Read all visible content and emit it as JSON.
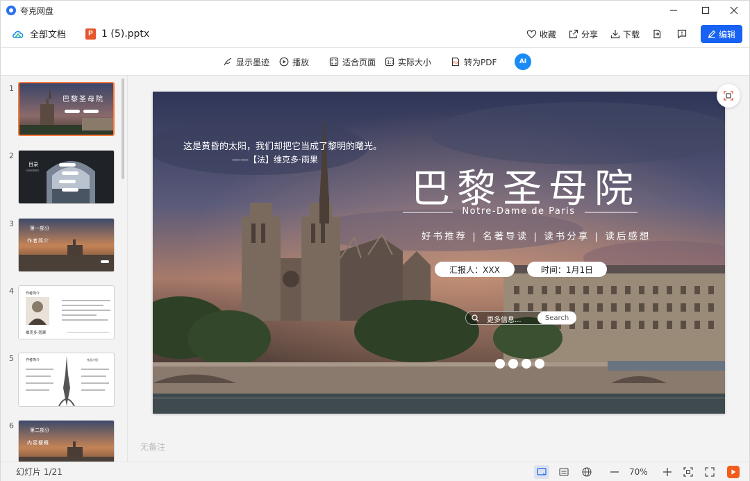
{
  "app": {
    "title": "夸克网盘"
  },
  "window_controls": {
    "minimize": "—",
    "maximize": "☐",
    "close": "✕"
  },
  "header": {
    "all_docs": "全部文档",
    "file_name": "1 (5).pptx",
    "ppt_badge": "P",
    "favorite": "收藏",
    "share": "分享",
    "download": "下载",
    "edit": "编辑"
  },
  "toolbar": {
    "show_ink": "显示墨迹",
    "play": "播放",
    "fit_page": "适合页面",
    "actual_size": "实际大小",
    "to_pdf": "转为PDF",
    "ai": "AI"
  },
  "thumbnails": [
    {
      "num": "1",
      "active": true
    },
    {
      "num": "2"
    },
    {
      "num": "3"
    },
    {
      "num": "4"
    },
    {
      "num": "5"
    },
    {
      "num": "6"
    }
  ],
  "thumb_text": {
    "t2_title": "目录",
    "t2_sub": "CONTENTS",
    "t3_title": "第一部分",
    "t3_sub": "作者简介",
    "t4_title": "作者简介",
    "t4_name": "维克多·雨果",
    "t5_title": "作者简介",
    "t5_right": "作品介绍",
    "t6_title": "第二部分",
    "t6_sub": "内容梗概"
  },
  "slide": {
    "quote": "这是黄昏的太阳，我们却把它当成了黎明的曙光。",
    "attribution": "——【法】维克多·雨果",
    "title": "巴黎圣母院",
    "subtitle": "Notre-Dame de Paris",
    "tagline": "好书推荐 | 名著导读 | 读书分享 | 读后感想",
    "reporter": "汇报人：XXX",
    "time": "时间：1月1日",
    "search_placeholder": "更多信息...",
    "search_button": "Search"
  },
  "notes_placeholder": "无备注",
  "status": {
    "slide_counter": "幻灯片 1/21",
    "zoom": "70%"
  },
  "colors": {
    "accent": "#1862f3",
    "thumb_active_border": "#ff7a3d",
    "ppt_orange": "#e5562c",
    "play_orange": "#f25c1c"
  }
}
